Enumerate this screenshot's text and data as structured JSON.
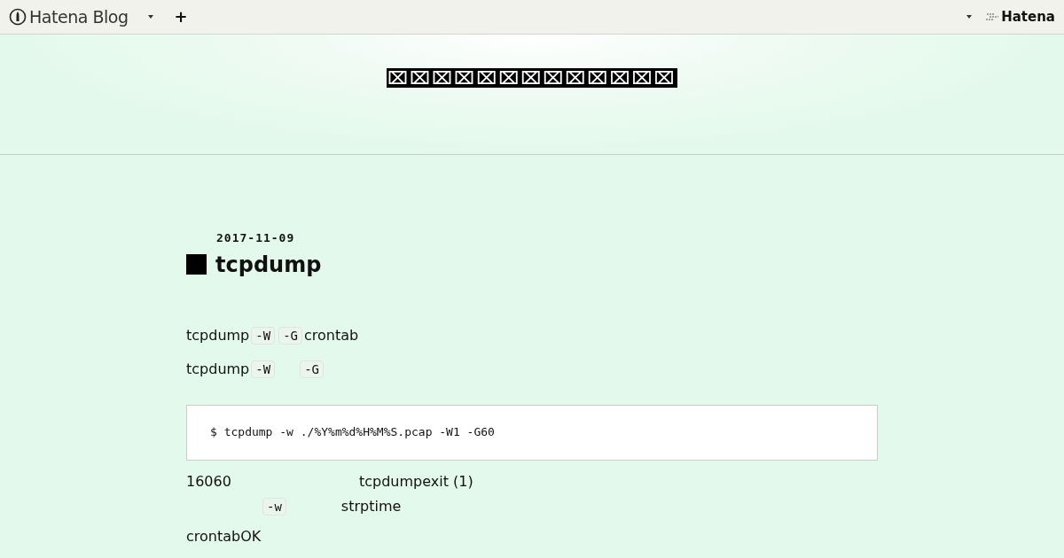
{
  "topbar": {
    "brand": "Hatena Blog",
    "add": "+",
    "account": "Hatena"
  },
  "blog_title": "⌧⌧⌧⌧⌧⌧⌧⌧⌧⌧⌧⌧⌧",
  "entry": {
    "date": "2017-11-09",
    "title": "tcpdump",
    "paragraphs": [
      [
        {
          "kind": "text",
          "text": "tcpdump"
        },
        {
          "kind": "code",
          "text": "-W"
        },
        {
          "kind": "code",
          "text": "-G"
        },
        {
          "kind": "text",
          "text": "crontab"
        }
      ],
      [
        {
          "kind": "text",
          "text": "tcpdump"
        },
        {
          "kind": "code",
          "text": "-W"
        },
        {
          "kind": "space"
        },
        {
          "kind": "code",
          "text": "-G"
        }
      ]
    ],
    "code_block": "$ tcpdump -w ./%Y%m%d%H%M%S.pcap -W1 -G60",
    "after": [
      [
        {
          "kind": "text",
          "text": "16060"
        },
        {
          "kind": "space"
        },
        {
          "kind": "text",
          "text": "tcpdumpexit (1)"
        }
      ],
      [
        {
          "kind": "space"
        },
        {
          "kind": "code",
          "text": "-w"
        },
        {
          "kind": "text",
          "text": "strptime"
        }
      ]
    ],
    "last": [
      [
        {
          "kind": "text",
          "text": "crontabOK"
        }
      ]
    ]
  }
}
